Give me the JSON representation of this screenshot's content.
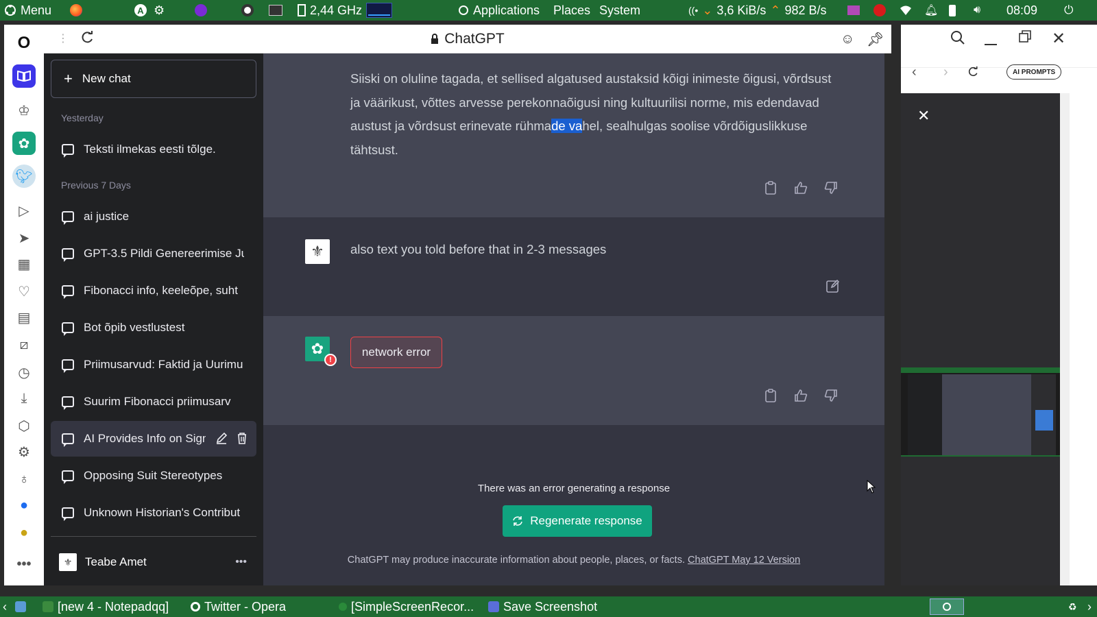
{
  "top_panel": {
    "menu_label": "Menu",
    "cpu_freq": "2,44 GHz",
    "applications_label": "Applications",
    "places_label": "Places",
    "system_label": "System",
    "net_down": "3,6 KiB/s",
    "net_up": "982 B/s",
    "clock": "08:09"
  },
  "browser": {
    "tab_title": "ChatGPT"
  },
  "sidebar": {
    "new_chat_label": "New chat",
    "groups": [
      {
        "label": "Yesterday",
        "items": [
          {
            "label": "Teksti ilmekas eesti tõlge."
          }
        ]
      },
      {
        "label": "Previous 7 Days",
        "items": [
          {
            "label": "ai justice"
          },
          {
            "label": "GPT-3.5 Pildi Genereerimise Ju"
          },
          {
            "label": "Fibonacci info, keeleõpe, suht"
          },
          {
            "label": "Bot õpib vestlustest"
          },
          {
            "label": "Priimusarvud: Faktid ja Uurimu"
          },
          {
            "label": "Suurim Fibonacci priimusarv"
          },
          {
            "label": "AI Provides Info on Sign"
          },
          {
            "label": "Opposing Suit Stereotypes"
          },
          {
            "label": "Unknown Historian's Contribut"
          }
        ]
      }
    ],
    "user_name": "Teabe Amet"
  },
  "conversation": {
    "assistant_text_before": "Siiski on oluline tagada, et sellised algatused austaksid kõigi inimeste õigusi, võrdsust ja väärikust, võttes arvesse perekonnaõigusi ning kultuurilisi norme, mis edendavad austust ja võrdsust erinevate rühma",
    "assistant_text_selected": "de va",
    "assistant_text_after": "hel, sealhulgas soolise võrdõiguslikkuse tähtsust.",
    "user_message": "also text you told before that in 2-3 messages",
    "error_message": "network error",
    "error_caption": "There was an error generating a response",
    "regenerate_label": "Regenerate response",
    "footer_text": "ChatGPT may produce inaccurate information about people, places, or facts. ",
    "footer_link": "ChatGPT May 12 Version"
  },
  "right_panel": {
    "ai_prompts_label": "AI PROMPTS"
  },
  "taskbar": {
    "items": [
      {
        "label": "[new 4 - Notepadqq]"
      },
      {
        "label": "Twitter - Opera"
      },
      {
        "label": "[SimpleScreenRecor..."
      },
      {
        "label": "Save Screenshot"
      }
    ]
  },
  "colors": {
    "panel_green": "#1f6b32",
    "sidebar_bg": "#202123",
    "main_bg": "#343541",
    "assistant_bg": "#444654",
    "accent_green": "#10a37f",
    "error_red": "#ef4146",
    "opera_active": "#3d35e8"
  },
  "icons": [
    "menu-icon",
    "firefox-icon",
    "cpu-icon",
    "wifi-icon",
    "battery-icon",
    "volume-icon",
    "power-icon",
    "lock-icon",
    "reload-icon",
    "pin-icon",
    "emoji-icon",
    "plus-icon",
    "chat-icon",
    "edit-icon",
    "trash-icon",
    "more-icon",
    "copy-icon",
    "thumbs-up-icon",
    "thumbs-down-icon",
    "regenerate-icon",
    "close-icon",
    "search-icon",
    "minimize-icon",
    "restore-icon"
  ]
}
